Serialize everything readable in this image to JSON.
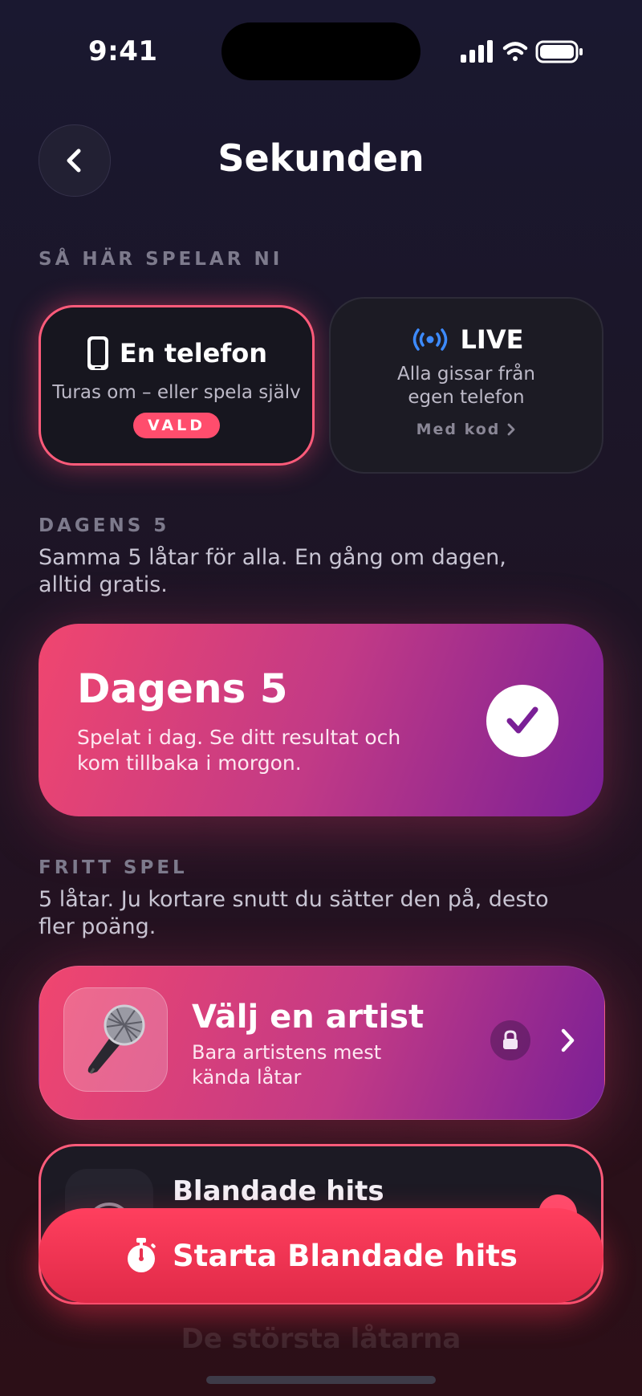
{
  "status_bar": {
    "time": "9:41"
  },
  "header": {
    "title": "Sekunden"
  },
  "play_mode": {
    "section_label": "SÅ HÄR SPELAR NI",
    "one_phone": {
      "title": "En telefon",
      "subtitle": "Turas om – eller spela själv",
      "badge": "VALD"
    },
    "live": {
      "title": "LIVE",
      "subtitle_line1": "Alla gissar från",
      "subtitle_line2": "egen telefon",
      "link": "Med kod"
    }
  },
  "daily": {
    "section_label": "DAGENS 5",
    "description_line1": "Samma 5 låtar för alla. En gång om dagen,",
    "description_line2": "alltid gratis.",
    "card_title": "Dagens 5",
    "card_desc_line1": "Spelat i dag. Se ditt resultat och",
    "card_desc_line2": "kom tillbaka i morgon."
  },
  "free_play": {
    "section_label": "FRITT SPEL",
    "description_line1": "5 låtar. Ju kortare snutt du sätter den på, desto",
    "description_line2": "fler poäng.",
    "artist": {
      "title": "Välj en artist",
      "desc_line1": "Bara artistens mest",
      "desc_line2": "kända låtar",
      "icon": "microphone-icon"
    },
    "mixed": {
      "title": "Blandade hits"
    },
    "next_faded": "De största låtarna"
  },
  "start_button": {
    "label": "Starta Blandade hits",
    "icon": "stopwatch-icon"
  },
  "colors": {
    "accent": "#ff4d6d",
    "gradient_start": "#f0466f",
    "gradient_end": "#7a1f96",
    "live_blue": "#3d8bff"
  }
}
